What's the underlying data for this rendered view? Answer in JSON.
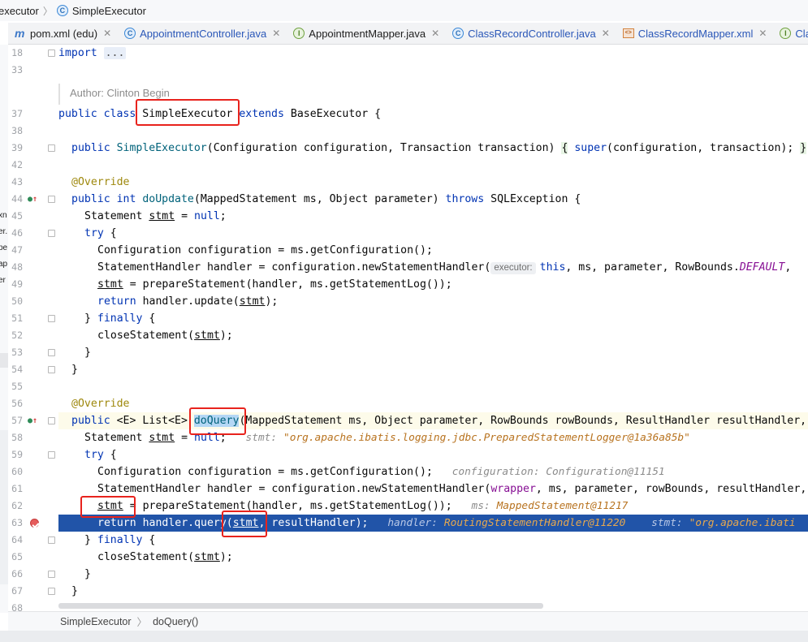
{
  "breadcrumb": {
    "items": [
      {
        "label": "executor",
        "icon": "none"
      },
      {
        "label": "SimpleExecutor",
        "icon": "class-icon"
      }
    ]
  },
  "tabs": [
    {
      "label": "pom.xml (edu)",
      "icon": "maven-icon",
      "color": "#1e1e1e",
      "closable": true
    },
    {
      "label": "AppointmentController.java",
      "icon": "class-icon",
      "color": "#2a57b8",
      "closable": true
    },
    {
      "label": "AppointmentMapper.java",
      "icon": "interface-icon",
      "color": "#1e1e1e",
      "closable": true
    },
    {
      "label": "ClassRecordController.java",
      "icon": "class-icon",
      "color": "#2a57b8",
      "closable": true
    },
    {
      "label": "ClassRecordMapper.xml",
      "icon": "xml-icon",
      "color": "#2a57b8",
      "closable": true
    },
    {
      "label": "Cla",
      "icon": "interface-icon",
      "color": "#2a57b8",
      "closable": false
    }
  ],
  "left_strip_fragments": [
    "xn",
    "er.",
    "ic",
    "pe",
    "ap",
    "er"
  ],
  "line_numbers": [
    "18",
    "33",
    "",
    "37",
    "38",
    "39",
    "42",
    "43",
    "44",
    "45",
    "46",
    "47",
    "48",
    "49",
    "50",
    "51",
    "52",
    "53",
    "54",
    "55",
    "56",
    "57",
    "58",
    "59",
    "60",
    "61",
    "62",
    "63",
    "64",
    "65",
    "66",
    "67",
    "68"
  ],
  "doc_comment": "Author: Clinton Begin",
  "code": {
    "l18_kw": "import",
    "l18_fold": "...",
    "l37_kw1": "public",
    "l37_kw2": "class",
    "l37_name": "SimpleExecutor",
    "l37_kw3": "extends",
    "l37_rest": "BaseExecutor {",
    "l39_kw": "public",
    "l39_sig": "SimpleExecutor",
    "l39_params": "(Configuration configuration, Transaction transaction) ",
    "l39_brace": "{",
    "l39_kw2": "super",
    "l39_body": "(configuration, transaction); ",
    "l39_end": "}",
    "l43_ann": "@Override",
    "l44_kw": "public int",
    "l44_name": "doUpdate",
    "l44_params": "(MappedStatement ms, Object parameter) ",
    "l44_throws": "throws",
    "l44_rest": " SQLException {",
    "l45_a": "Statement ",
    "l45_var": "stmt",
    "l45_b": " = ",
    "l45_null": "null",
    "l45_c": ";",
    "l46_kw": "try",
    "l46_rest": " {",
    "l47": "Configuration configuration = ms.getConfiguration();",
    "l48_a": "StatementHandler handler = configuration.newStatementHandler(",
    "l48_hint": "executor:",
    "l48_this": "this",
    "l48_b": ", ms, parameter, RowBounds.",
    "l48_field": "DEFAULT",
    "l48_c": ",",
    "l49_var": "stmt",
    "l49_rest": " = prepareStatement(handler, ms.getStatementLog());",
    "l50_kw": "return",
    "l50_a": " handler.update(",
    "l50_var": "stmt",
    "l50_b": ");",
    "l51_a": "} ",
    "l51_kw": "finally",
    "l51_b": " {",
    "l52_a": "closeStatement(",
    "l52_var": "stmt",
    "l52_b": ");",
    "l53": "}",
    "l54": "}",
    "l56_ann": "@Override",
    "l57_kw": "public",
    "l57_a": " <E> List<E> ",
    "l57_name": "doQuery",
    "l57_params": "(MappedStatement ms, Object parameter, RowBounds rowBounds, ResultHandler resultHandler,",
    "l58_a": "Statement ",
    "l58_var": "stmt",
    "l58_b": " = ",
    "l58_null": "null",
    "l58_c": ";",
    "l58_dbg_label": "stmt:",
    "l58_dbg_val": "\"org.apache.ibatis.logging.jdbc.PreparedStatementLogger@1a36a85b\"",
    "l59_kw": "try",
    "l59_rest": " {",
    "l60": "Configuration configuration = ms.getConfiguration();",
    "l60_dbg": "configuration: Configuration@11151",
    "l61_a": "StatementHandler handler = configuration.newStatementHandler(",
    "l61_wrapper": "wrapper",
    "l61_b": ", ms, parameter, rowBounds, resultHandler,",
    "l62_var": "stmt",
    "l62_rest": " = prepareStatement(handler, ms.getStatementLog());",
    "l62_dbg_label": "ms:",
    "l62_dbg_val": "MappedStatement@11217",
    "l63_kw": "return",
    "l63_a": " handler.query(",
    "l63_var": "stmt",
    "l63_b": ", resultHandler);",
    "l63_dbg1_label": "handler:",
    "l63_dbg1_val": "RoutingStatementHandler@11220",
    "l63_dbg2_label": "stmt:",
    "l63_dbg2_val": "\"org.apache.ibati",
    "l64_a": "} ",
    "l64_kw": "finally",
    "l64_b": " {",
    "l65_a": "closeStatement(",
    "l65_var": "stmt",
    "l65_b": ");",
    "l66": "}",
    "l67": "}"
  },
  "navbar": {
    "items": [
      "SimpleExecutor",
      "doQuery()"
    ]
  },
  "colors": {
    "keyword": "#0033b3",
    "annotation": "#9e880d",
    "execution_line": "#2154a8",
    "highlight_box": "#e8231d",
    "debug_value": "#b87320"
  }
}
